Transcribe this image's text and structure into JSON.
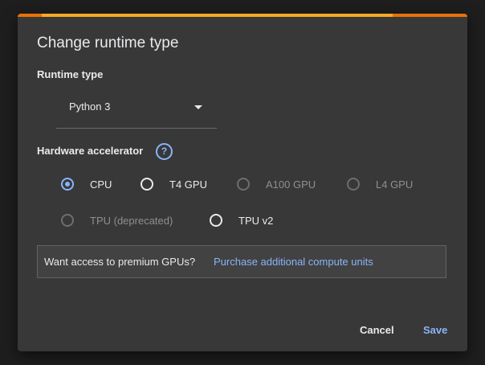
{
  "dialog": {
    "title": "Change runtime type",
    "progress_fraction": 0.78,
    "accent_color": "#e8710a",
    "progress_color": "#f9a825"
  },
  "runtime": {
    "label": "Runtime type",
    "selected": "Python 3"
  },
  "hardware": {
    "label": "Hardware accelerator",
    "help_icon": "?",
    "options": [
      {
        "label": "CPU",
        "checked": true,
        "disabled": false
      },
      {
        "label": "T4 GPU",
        "checked": false,
        "disabled": false
      },
      {
        "label": "A100 GPU",
        "checked": false,
        "disabled": true
      },
      {
        "label": "L4 GPU",
        "checked": false,
        "disabled": true
      },
      {
        "label": "TPU (deprecated)",
        "checked": false,
        "disabled": true
      },
      {
        "label": "TPU v2",
        "checked": false,
        "disabled": false
      }
    ]
  },
  "notice": {
    "text": "Want access to premium GPUs?",
    "link": "Purchase additional compute units"
  },
  "buttons": {
    "cancel": "Cancel",
    "save": "Save"
  },
  "colors": {
    "link": "#8ab4f8",
    "surface": "#383838"
  }
}
